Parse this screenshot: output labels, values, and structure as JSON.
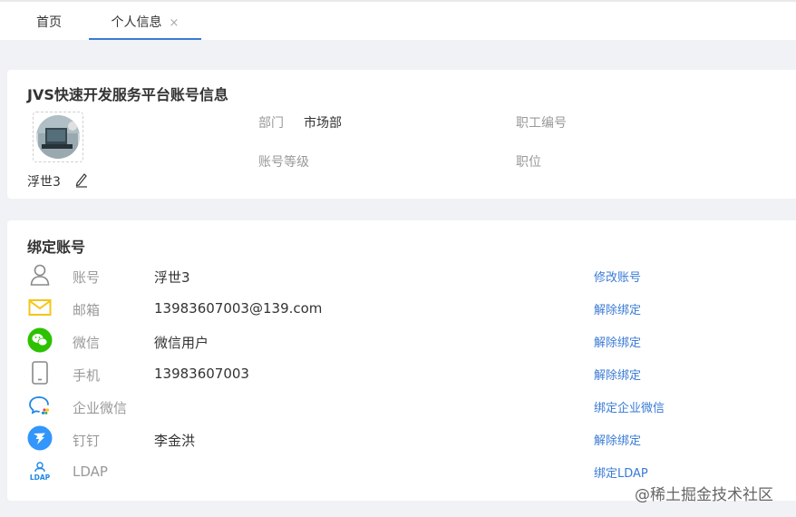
{
  "tabs": [
    {
      "label": "首页",
      "active": false
    },
    {
      "label": "个人信息",
      "active": true,
      "close": "×"
    }
  ],
  "profile": {
    "title": "JVS快速开发服务平台账号信息",
    "user_name": "浮世3",
    "fields": {
      "department_label": "部门",
      "department_value": "市场部",
      "employee_no_label": "职工编号",
      "employee_no_value": "",
      "account_level_label": "账号等级",
      "account_level_value": "",
      "position_label": "职位",
      "position_value": ""
    }
  },
  "bindings": {
    "title": "绑定账号",
    "rows": [
      {
        "icon": "user-icon",
        "label": "账号",
        "value": "浮世3",
        "action": "修改账号"
      },
      {
        "icon": "mail-icon",
        "label": "邮箱",
        "value": "13983607003@139.com",
        "action": "解除绑定"
      },
      {
        "icon": "wechat-icon",
        "label": "微信",
        "value": "微信用户",
        "action": "解除绑定"
      },
      {
        "icon": "phone-icon",
        "label": "手机",
        "value": "13983607003",
        "action": "解除绑定"
      },
      {
        "icon": "wecom-icon",
        "label": "企业微信",
        "value": "",
        "action": "绑定企业微信"
      },
      {
        "icon": "dingtalk-icon",
        "label": "钉钉",
        "value": "李金洪",
        "action": "解除绑定"
      },
      {
        "icon": "ldap-icon",
        "label": "LDAP",
        "value": "",
        "action": "绑定LDAP",
        "icon_text": "LDAP"
      }
    ]
  },
  "watermark": "@稀土掘金技术社区",
  "colors": {
    "accent": "#3a7bd5",
    "mail": "#f5c518",
    "wechat": "#2dc100",
    "dingtalk": "#3296fa",
    "ldap": "#1e88e5"
  }
}
